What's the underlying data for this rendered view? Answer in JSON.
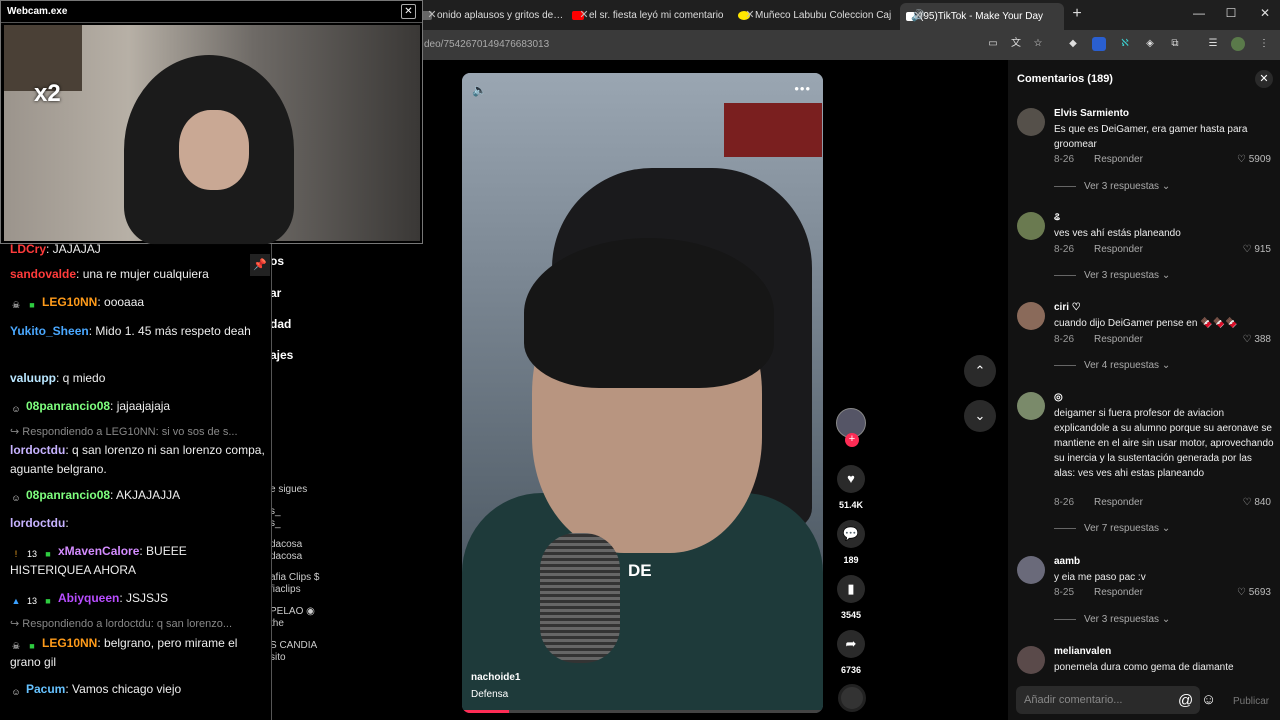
{
  "browser": {
    "tabs": [
      {
        "title": "onido aplausos y gritos del pu",
        "color": "#888888"
      },
      {
        "title": "el sr. fiesta leyó mi comentario",
        "color": "#ff0000"
      },
      {
        "title": "Muñeco Labubu Coleccion Caj",
        "color": "#ffe600"
      },
      {
        "title": "(95)TikTok - Make Your Day",
        "color": "#ffffff"
      }
    ],
    "new_tab": "+",
    "url": "deo/7542670149476683013",
    "window": {
      "minimize": "—",
      "maximize": "☐",
      "close": "✕"
    }
  },
  "webcam": {
    "title": "Webcam.exe",
    "close": "✕",
    "multiplier": "x2"
  },
  "chat": {
    "lines": [
      {
        "user": "LDCry",
        "color": "#ff3b3b",
        "text": "JAJAJAJ"
      },
      {
        "user": "sandovalde",
        "color": "#ff3b3b",
        "text": "una re mujer cualquiera"
      },
      {
        "user": "LEG10NN",
        "color": "#ff9b1a",
        "text": "oooaaa",
        "badges": [
          "☠",
          "■"
        ]
      },
      {
        "user": "Yukito_Sheen",
        "color": "#4aa8ff",
        "text": "Mido 1. 45 más respeto deah"
      },
      {
        "user": "valuupp",
        "color": "#b9e6ff",
        "text": "q miedo"
      },
      {
        "user": "08panrancio08",
        "color": "#7fff7f",
        "text": "jajaajajaja",
        "badges": [
          "☺"
        ]
      },
      {
        "reply": "Respondiendo a LEG10NN: si vo sos de s..."
      },
      {
        "user": "lordoctdu",
        "color": "#c7b3ff",
        "text": "q san lorenzo ni san lorenzo compa, aguante belgrano."
      },
      {
        "user": "08panrancio08",
        "color": "#7fff7f",
        "text": "AKJAJAJJA",
        "badges": [
          "☺"
        ]
      },
      {
        "user": "lordoctdu",
        "color": "#c7b3ff",
        "text": ""
      },
      {
        "user": "xMavenCalore",
        "color": "#d48cff",
        "text": "BUEEE HISTERIQUEA AHORA",
        "badges": [
          "!",
          "13",
          "■"
        ]
      },
      {
        "user": "Abiyqueen",
        "color": "#b84dff",
        "text": "JSJSJS",
        "badges": [
          "▲",
          "13",
          "■"
        ]
      },
      {
        "reply": "Respondiendo a lordoctdu: q san lorenzo..."
      },
      {
        "user": "LEG10NN",
        "color": "#ff9b1a",
        "text": "belgrano, pero mirame el grano gil",
        "badges": [
          "☠",
          "■"
        ]
      },
      {
        "user": "Pacum",
        "color": "#66c2ff",
        "text": "Vamos chicago viejo",
        "badges": [
          "☺"
        ]
      }
    ]
  },
  "leftnav": {
    "items": [
      "os",
      "ar",
      "dad",
      "ajes"
    ],
    "follows_title": "e sigues",
    "follows": [
      "s_",
      "s_",
      "dacosa",
      "dacosa",
      "afia Clips $",
      "fiaclips",
      "PELAO ◉",
      "the",
      "S CANDIA",
      "sito"
    ]
  },
  "video": {
    "user": "nachoide1",
    "description": "Defensa",
    "caption": "DE",
    "mute_icon": "🔈",
    "more_icon": "•••",
    "progress": 0.13,
    "actions": {
      "likes": "51.4K",
      "comments": "189",
      "saves": "3545",
      "shares": "6736"
    },
    "plus": "+",
    "up": "⌃",
    "down": "⌄"
  },
  "comments": {
    "title": "Comentarios (189)",
    "close": "✕",
    "items": [
      {
        "name": "Elvis Sarmiento",
        "text": "Es que es DeiGamer, era gamer hasta para groomear",
        "date": "8-26",
        "reply": "Responder",
        "likes": "5909",
        "replies": "Ver 3 respuestas ⌄",
        "avatar": "#55504a"
      },
      {
        "name": "ଌ",
        "text": "ves ves ahí estás planeando",
        "date": "8-26",
        "reply": "Responder",
        "likes": "915",
        "replies": "Ver 3 respuestas ⌄",
        "avatar": "#6a7a50"
      },
      {
        "name": "ciri ♡",
        "text": "cuando dijo DeiGamer pense en 🍫🍫🍫",
        "date": "8-26",
        "reply": "Responder",
        "likes": "388",
        "replies": "Ver 4 respuestas ⌄",
        "avatar": "#8a6a5a"
      },
      {
        "name": "◎",
        "text": "deigamer si fuera profesor de aviacion explicandole a su alumno porque su aeronave se mantiene en el aire sin usar motor, aprovechando su inercia y la sustentación generada por las alas: ves ves ahi estas planeando",
        "date": "8-26",
        "reply": "Responder",
        "likes": "840",
        "replies": "Ver 7 respuestas ⌄",
        "avatar": "#7a8a6a"
      },
      {
        "name": "aamb",
        "text": "y eia me paso pac :v",
        "date": "8-25",
        "reply": "Responder",
        "likes": "5693",
        "replies": "Ver 3 respuestas ⌄",
        "avatar": "#6a6a7a"
      },
      {
        "name": "melianvalen",
        "text": "ponemela dura como gema de diamante",
        "avatar": "#5a4a4a"
      }
    ],
    "input_placeholder": "Añadir comentario...",
    "at_icon": "@",
    "emoji_icon": "☺",
    "publish": "Publicar"
  }
}
